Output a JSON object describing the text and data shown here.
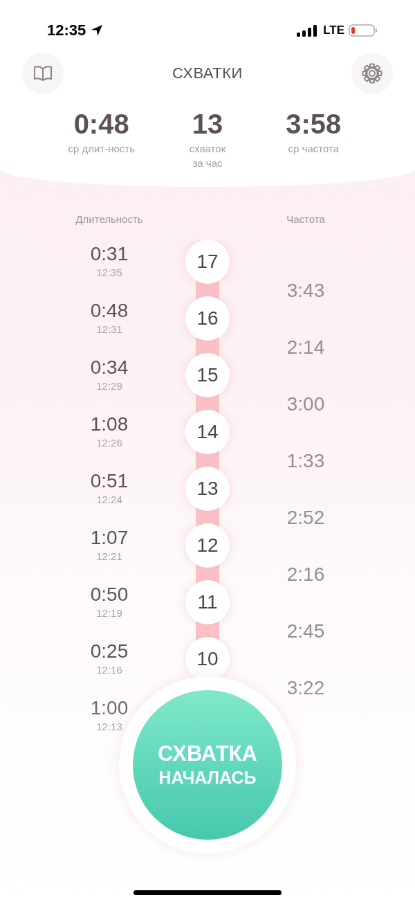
{
  "status_bar": {
    "time": "12:35",
    "network": "LTE"
  },
  "header": {
    "title": "СХВАТКИ"
  },
  "stats": [
    {
      "value": "0:48",
      "label_lines": [
        "ср длит-ность"
      ]
    },
    {
      "value": "13",
      "label_lines": [
        "схваток",
        "за час"
      ]
    },
    {
      "value": "3:58",
      "label_lines": [
        "ср частота"
      ]
    }
  ],
  "columns": {
    "duration": "Длительность",
    "frequency": "Частота"
  },
  "contractions": [
    {
      "number": "17",
      "duration": "0:31",
      "start": "12:35",
      "frequency": "3:43"
    },
    {
      "number": "16",
      "duration": "0:48",
      "start": "12:31",
      "frequency": "2:14"
    },
    {
      "number": "15",
      "duration": "0:34",
      "start": "12:29",
      "frequency": "3:00"
    },
    {
      "number": "14",
      "duration": "1:08",
      "start": "12:26",
      "frequency": "1:33"
    },
    {
      "number": "13",
      "duration": "0:51",
      "start": "12:24",
      "frequency": "2:52"
    },
    {
      "number": "12",
      "duration": "1:07",
      "start": "12:21",
      "frequency": "2:16"
    },
    {
      "number": "11",
      "duration": "0:50",
      "start": "12:19",
      "frequency": "2:45"
    },
    {
      "number": "10",
      "duration": "0:25",
      "start": "12:16",
      "frequency": "3:22"
    },
    {
      "duration": "1:00",
      "start": "12:13"
    }
  ],
  "primary_button": {
    "lines": [
      "СХВАТКА",
      "НАЧАЛАСЬ"
    ]
  }
}
